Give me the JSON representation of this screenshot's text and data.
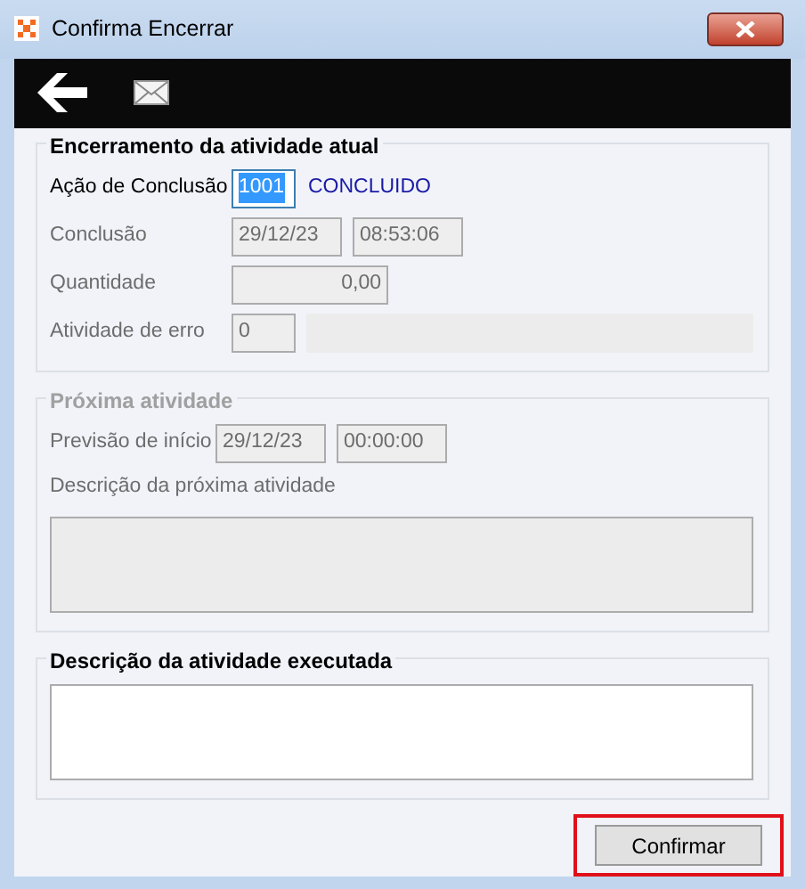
{
  "window": {
    "title": "Confirma Encerrar"
  },
  "sections": [
    {
      "title": "Encerramento da atividade atual",
      "disabled": false,
      "rows": [
        {
          "kind": "fields",
          "label": "Ação de Conclusão",
          "disabled": false,
          "fields": [
            {
              "kind": "code",
              "value": "1001",
              "selected": true
            }
          ],
          "note": "CONCLUIDO"
        },
        {
          "kind": "fields",
          "label": "Conclusão",
          "disabled": true,
          "fields": [
            {
              "kind": "date",
              "value": "29/12/23",
              "selected": false
            },
            {
              "kind": "time",
              "value": "08:53:06",
              "selected": false
            }
          ]
        },
        {
          "kind": "fields",
          "label": "Quantidade",
          "disabled": true,
          "fields": [
            {
              "kind": "number",
              "value": "0,00",
              "selected": false
            }
          ]
        },
        {
          "kind": "fields",
          "label": "Atividade de erro",
          "disabled": true,
          "fields": [
            {
              "kind": "code",
              "value": "0",
              "selected": false
            },
            {
              "kind": "wide",
              "selected": false
            }
          ]
        }
      ]
    },
    {
      "title": "Próxima atividade",
      "disabled": true,
      "rows": [
        {
          "kind": "fields",
          "label": "Previsão de início",
          "disabled": true,
          "fields": [
            {
              "kind": "date",
              "value": "29/12/23",
              "selected": false
            },
            {
              "kind": "time",
              "value": "00:00:00",
              "selected": false
            }
          ]
        },
        {
          "kind": "textarea",
          "label": "Descrição da próxima atividade",
          "disabled": true
        }
      ]
    },
    {
      "title": "Descrição da atividade executada",
      "disabled": false,
      "rows": [
        {
          "kind": "textarea",
          "disabled": false
        }
      ]
    }
  ],
  "buttons": [
    {
      "label": "Confirmar",
      "highlighted": true
    }
  ]
}
